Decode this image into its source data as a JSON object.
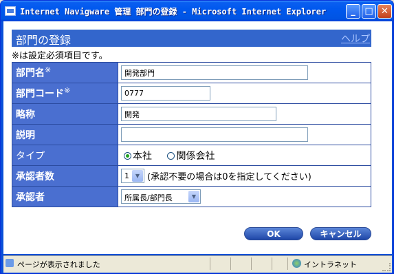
{
  "window": {
    "title": "Internet Navigware 管理 部門の登録 - Microsoft Internet Explorer",
    "min_glyph": "_",
    "max_glyph": "□",
    "close_glyph": "✕"
  },
  "page": {
    "heading": "部門の登録",
    "help_link": "ヘルプ",
    "required_note": "※は設定必須項目です。"
  },
  "form": {
    "name": {
      "label": "部門名",
      "mark": "※",
      "value": "開発部門"
    },
    "code": {
      "label": "部門コード",
      "mark": "※",
      "value": "0777"
    },
    "abbr": {
      "label": "略称",
      "value": "開発"
    },
    "description": {
      "label": "説明",
      "value": ""
    },
    "type": {
      "label": "タイプ",
      "options": [
        {
          "label": "本社",
          "selected": true
        },
        {
          "label": "関係会社",
          "selected": false
        }
      ]
    },
    "approver_count": {
      "label": "承認者数",
      "value": "1",
      "note": "(承認不要の場合は0を指定してください)"
    },
    "approver": {
      "label": "承認者",
      "value": "所属長/部門長"
    }
  },
  "buttons": {
    "ok": "OK",
    "cancel": "キャンセル"
  },
  "status": {
    "text": "ページが表示されました",
    "zone": "イントラネット"
  },
  "colors": {
    "titlebar": "#0054e3",
    "heading_bar": "#3366cc",
    "label_cell": "#4a6fd0",
    "button": "#1f47a8"
  }
}
